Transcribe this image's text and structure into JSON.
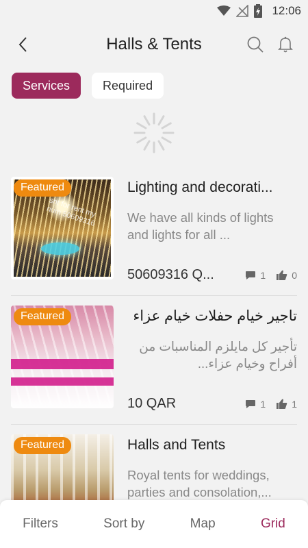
{
  "status_bar": {
    "time": "12:06"
  },
  "app_bar": {
    "title": "Halls & Tents"
  },
  "tabs": [
    {
      "label": "Services",
      "active": true
    },
    {
      "label": "Required",
      "active": false
    }
  ],
  "listings": [
    {
      "badge": "Featured",
      "title": "Lighting and decorati...",
      "description": "We have all kinds of lights and lights for all ...",
      "price": "50609316 Q...",
      "comments": "1",
      "likes": "0",
      "image_watermark": "snt for rent my num 50609316"
    },
    {
      "badge": "Featured",
      "title": "تاجير خيام حفلات خيام عزاء",
      "description": "تأجير كل مايلزم المناسبات من أفراح وخيام عزاء...",
      "price": "10 QAR",
      "comments": "1",
      "likes": "1"
    },
    {
      "badge": "Featured",
      "title": "Halls and Tents",
      "description": "Royal tents for weddings, parties and consolation,...",
      "price": "",
      "comments": "",
      "likes": ""
    }
  ],
  "bottom_bar": {
    "filters": "Filters",
    "sort_by": "Sort by",
    "map": "Map",
    "grid": "Grid"
  },
  "colors": {
    "accent": "#9c2a5c",
    "badge": "#ee8a10",
    "background": "#f2f2f2"
  }
}
